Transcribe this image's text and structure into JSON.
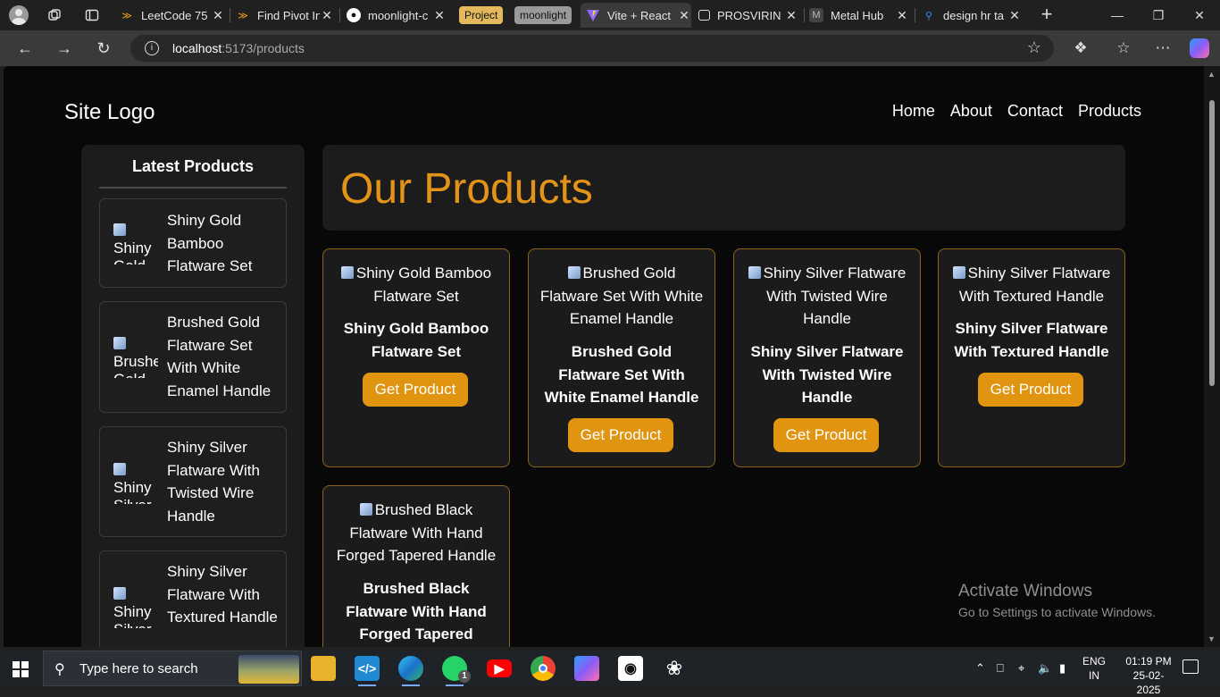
{
  "browser": {
    "tabs": [
      {
        "title": "LeetCode 75",
        "favicon": "leetcode-icon",
        "active": false
      },
      {
        "title": "Find Pivot In",
        "favicon": "leetcode-icon",
        "active": false
      },
      {
        "title": "moonlight-c",
        "favicon": "github-icon",
        "active": false
      },
      {
        "title": "Vite + React",
        "favicon": "vite-icon",
        "active": true
      },
      {
        "title": "PROSVIRIN",
        "favicon": "chat-icon",
        "active": false
      },
      {
        "title": "Metal Hub",
        "favicon": "metalhub-icon",
        "active": false
      },
      {
        "title": "design hr ta",
        "favicon": "search-icon",
        "active": false
      }
    ],
    "tab_groups": [
      {
        "label": "Project",
        "color": "#e3b95c"
      },
      {
        "label": "moonlight",
        "color": "#9a9a9a"
      }
    ],
    "url_host": "localhost",
    "url_path": ":5173/products"
  },
  "site": {
    "logo": "Site Logo",
    "nav": [
      "Home",
      "About",
      "Contact",
      "Products"
    ]
  },
  "sidebar": {
    "heading": "Latest Products",
    "items": [
      {
        "thumb_alt": "Shiny Gold",
        "name": "Shiny Gold Bamboo Flatware Set"
      },
      {
        "thumb_alt": "Brushed Gold",
        "name": "Brushed Gold Flatware Set With White Enamel Handle"
      },
      {
        "thumb_alt": "Shiny Silver",
        "name": "Shiny Silver Flatware With Twisted Wire Handle"
      },
      {
        "thumb_alt": "Shiny Silver",
        "name": "Shiny Silver Flatware With Textured Handle"
      }
    ]
  },
  "main": {
    "heading": "Our Products",
    "heading_color": "#e39418",
    "button_label": "Get Product",
    "accent_color": "#e1940f",
    "products": [
      {
        "image_alt": "Shiny Gold Bamboo Flatware Set",
        "title": "Shiny Gold Bamboo Flatware Set"
      },
      {
        "image_alt": "Brushed Gold Flatware Set With White Enamel Handle",
        "title": "Brushed Gold Flatware Set With White Enamel Handle"
      },
      {
        "image_alt": "Shiny Silver Flatware With Twisted Wire Handle",
        "title": "Shiny Silver Flatware With Twisted Wire Handle"
      },
      {
        "image_alt": "Shiny Silver Flatware With Textured Handle",
        "title": "Shiny Silver Flatware With Textured Handle"
      },
      {
        "image_alt": "Brushed Black Flatware With Hand Forged Tapered Handle",
        "title": "Brushed Black Flatware With Hand Forged Tapered"
      }
    ]
  },
  "watermark": {
    "line1": "Activate Windows",
    "line2": "Go to Settings to activate Windows."
  },
  "taskbar": {
    "search_placeholder": "Type here to search",
    "apps": [
      "file-explorer-icon",
      "vscode-icon",
      "edge-icon",
      "whatsapp-icon",
      "youtube-icon",
      "chrome-icon",
      "copilot-icon",
      "github-icon",
      "chatgpt-icon"
    ],
    "whatsapp_badge": "1",
    "lang_top": "ENG",
    "lang_bottom": "IN",
    "time": "01:19 PM",
    "date": "25-02-2025"
  }
}
